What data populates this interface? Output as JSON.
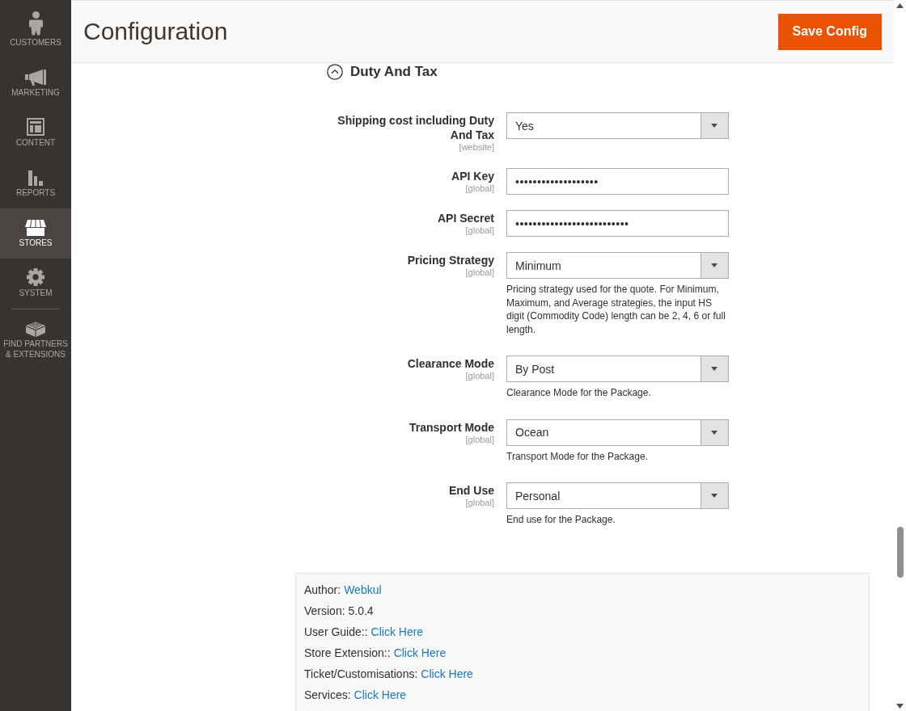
{
  "sidebar": {
    "items": [
      {
        "label": "CUSTOMERS",
        "selected": false
      },
      {
        "label": "MARKETING",
        "selected": false
      },
      {
        "label": "CONTENT",
        "selected": false
      },
      {
        "label": "REPORTS",
        "selected": false
      },
      {
        "label": "STORES",
        "selected": true
      },
      {
        "label": "SYSTEM",
        "selected": false
      },
      {
        "label": "FIND PARTNERS & EXTENSIONS",
        "selected": false
      }
    ]
  },
  "page_header": {
    "title": "Configuration",
    "save_button": "Save Config"
  },
  "section": {
    "title": "Duty And Tax",
    "expanded": true
  },
  "fields": [
    {
      "kind": "select",
      "label": "Shipping cost including Duty And Tax",
      "scope": "[website]",
      "value": "Yes"
    },
    {
      "kind": "password",
      "label": "API Key",
      "scope": "[global]",
      "value": "•••••••••••••••••••"
    },
    {
      "kind": "password",
      "label": "API Secret",
      "scope": "[global]",
      "value": "••••••••••••••••••••••••••"
    },
    {
      "kind": "select",
      "label": "Pricing Strategy",
      "scope": "[global]",
      "value": "Minimum",
      "note": "Pricing strategy used for the quote. For Minimum, Maximum, and Average strategies, the input HS digit (Commodity Code) length can be 2, 4, 6 or full length."
    },
    {
      "kind": "select",
      "label": "Clearance Mode",
      "scope": "[global]",
      "value": "By Post",
      "note": "Clearance Mode for the Package."
    },
    {
      "kind": "select",
      "label": "Transport Mode",
      "scope": "[global]",
      "value": "Ocean",
      "note": "Transport Mode for the Package."
    },
    {
      "kind": "select",
      "label": "End Use",
      "scope": "[global]",
      "value": "Personal",
      "note": "End use for the Package."
    }
  ],
  "info_box": {
    "lines": [
      {
        "label": "Author:",
        "link": "Webkul"
      },
      {
        "label": "Version: 5.0.4"
      },
      {
        "label": "User Guide::",
        "link": "Click Here"
      },
      {
        "label": "Store Extension::",
        "link": "Click Here"
      },
      {
        "label": "Ticket/Customisations:",
        "link": "Click Here"
      },
      {
        "label": "Services:",
        "link": "Click Here"
      }
    ]
  }
}
